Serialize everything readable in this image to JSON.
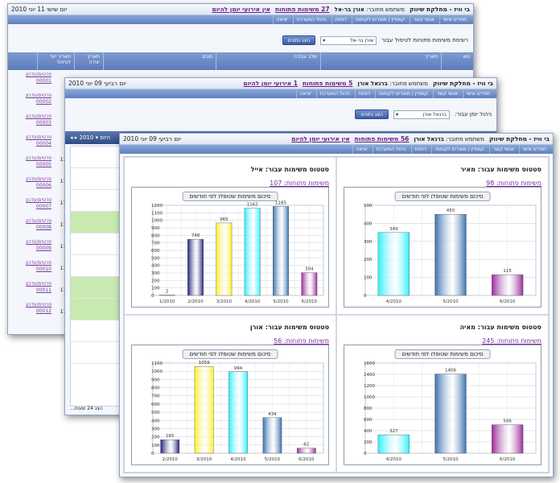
{
  "app": {
    "dept_title": "בי וויז - מחלקת שיווק",
    "connected_label": "משתמש מחובר:",
    "menu": [
      "תפריט אישי",
      "אנשי קשר",
      "קמפיין / מוצרים לקוחות",
      "דוחות",
      "ניהול המערכת",
      "יציאה"
    ]
  },
  "win_back": {
    "user": "אורן בר-אל",
    "open_tasks": "27 משימות פתוחות",
    "no_events": "אין אירועי יומן להיום",
    "date": "יום שישי 11 יוני 2010",
    "filter_label": "רשימת משימות פתוחות לטיפול עבור",
    "filter_value": "אורן בר-אל",
    "show_button": "הצג נתונים",
    "columns": [
      "נוש",
      "תאריך",
      "שלב עבודה",
      "סוכם",
      "תאריך יצירה",
      "תאריך יעד לטיפול"
    ],
    "row_links": [
      "פרטים/עדכון 00001",
      "פרטים/עדכון 00002",
      "פרטים/עדכון 00003",
      "פרטים/עדכון 00004",
      "פרטים/עדכון 00005",
      "פרטים/עדכון 00006",
      "פרטים/עדכון 00007",
      "פרטים/עדכון 00008",
      "פרטים/עדכון 00009",
      "פרטים/עדכון 00010",
      "פרטים/עדכון 00011",
      "פרטים/עדכון 00012"
    ],
    "date_cells": [
      "11/6",
      "11/6",
      "11/6",
      "11/6",
      "11/6",
      "11/6",
      "11/6",
      "11/6"
    ]
  },
  "win_mid": {
    "user": "ברגאל אורן",
    "open_tasks": "5 משימות פתוחות",
    "no_events": "1 אירועי יומן להיום",
    "date": "יום רביעי 09 יוני 2010",
    "filter_label": "ניהול יומן עבור:",
    "filter_value": "ברגאל אורן",
    "show_button": "הצג נתונים",
    "bar_text": "◂ ▸  היום  ▾ 2010",
    "footer": "הצג 24 שעות..."
  },
  "win_front": {
    "user": "ברגאל אורן",
    "open_tasks": "56 משימות פתוחות",
    "no_events": "אין אירועי יומן להיום",
    "date": "יום רביעי 09 יוני 2010",
    "panels": [
      {
        "title": "סטטוס משימות עבור: מאיר",
        "open": "משימות פתוחות: 98"
      },
      {
        "title": "סטטוס משימות עבור: אייל",
        "open": "משימות פתוחות: 107"
      },
      {
        "title": "סטטוס משימות עבור: מאיה",
        "open": "משימות פתוחות: 245"
      },
      {
        "title": "סטטוס משימות עבור: אורן",
        "open": "משימות פתוחות: 56"
      }
    ],
    "chart_title": "סיכום משימות שטופלו לפי חודשים"
  },
  "chart_data": [
    {
      "type": "bar",
      "panel": "מאיר",
      "categories": [
        "4/2010",
        "5/2010",
        "6/2010"
      ],
      "values": [
        349,
        450,
        115
      ],
      "ylim": [
        0,
        500
      ],
      "yticks": [
        0,
        100,
        200,
        300,
        400,
        500
      ],
      "colors": [
        "#2ff0ff",
        "#3a6fb0",
        "#9a2a9a"
      ]
    },
    {
      "type": "bar",
      "panel": "אייל",
      "categories": [
        "1/2010",
        "2/2010",
        "3/2010",
        "4/2010",
        "5/2010",
        "6/2010"
      ],
      "values": [
        2,
        748,
        965,
        1162,
        1185,
        304
      ],
      "ylim": [
        0,
        1200
      ],
      "yticks": [
        0,
        100,
        200,
        300,
        400,
        500,
        600,
        700,
        800,
        900,
        1000,
        1100,
        1200
      ],
      "colors": [
        "#cccccc",
        "#1c1c7a",
        "#ffee22",
        "#2ff0ff",
        "#3a6fb0",
        "#9a2a9a"
      ]
    },
    {
      "type": "bar",
      "panel": "מאיה",
      "categories": [
        "4/2010",
        "5/2010",
        "6/2010"
      ],
      "values": [
        327,
        1406,
        506
      ],
      "ylim": [
        0,
        1600
      ],
      "yticks": [
        0,
        200,
        400,
        600,
        800,
        1000,
        1200,
        1400,
        1600
      ],
      "colors": [
        "#2ff0ff",
        "#3a6fb0",
        "#9a2a9a"
      ]
    },
    {
      "type": "bar",
      "panel": "אורן",
      "categories": [
        "2/2010",
        "3/2010",
        "4/2010",
        "5/2010",
        "6/2010"
      ],
      "values": [
        165,
        1059,
        994,
        434,
        62
      ],
      "ylim": [
        0,
        1100
      ],
      "yticks": [
        0,
        100,
        200,
        300,
        400,
        500,
        600,
        700,
        800,
        900,
        1000,
        1100
      ],
      "colors": [
        "#1c1c7a",
        "#ffee22",
        "#2ff0ff",
        "#3a6fb0",
        "#9a2a9a"
      ]
    }
  ]
}
